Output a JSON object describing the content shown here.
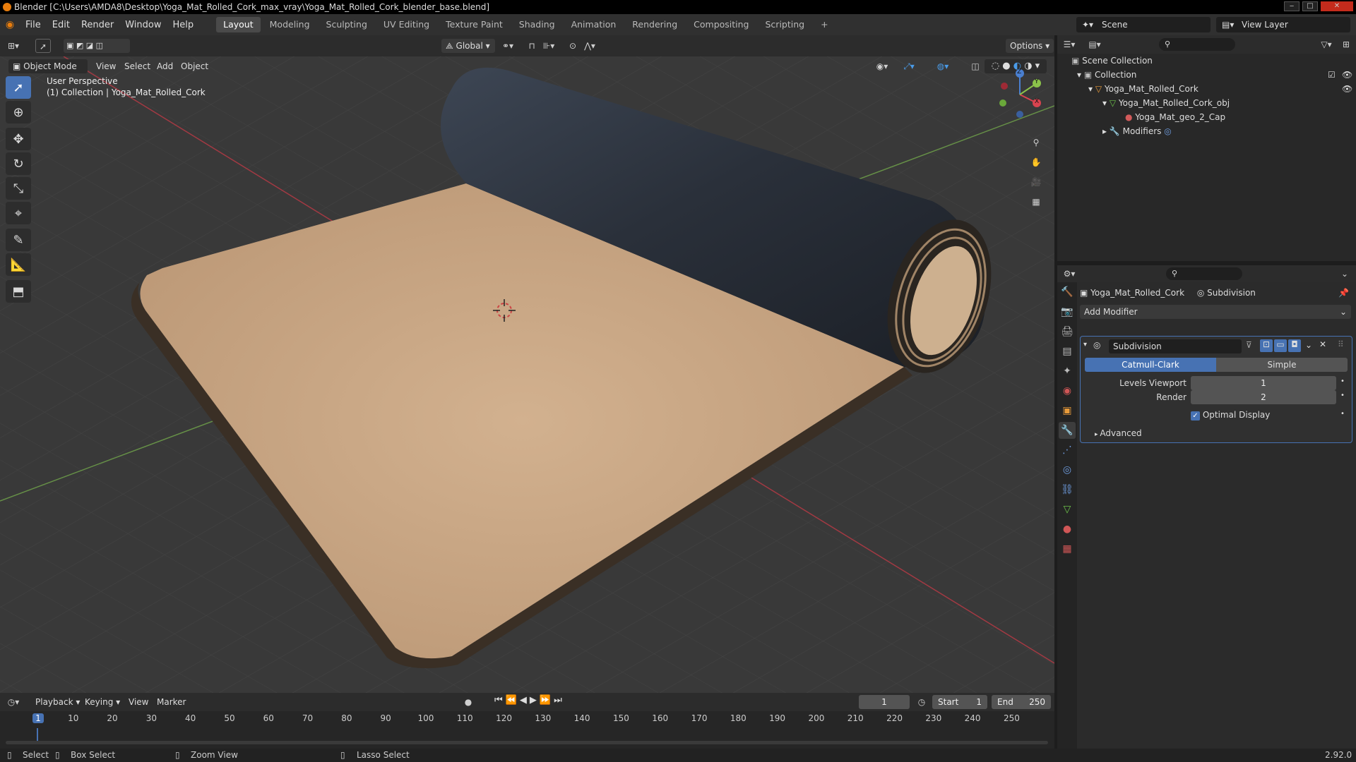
{
  "window": {
    "title": "Blender [C:\\Users\\AMDA8\\Desktop\\Yoga_Mat_Rolled_Cork_max_vray\\Yoga_Mat_Rolled_Cork_blender_base.blend]",
    "min_label": "‒",
    "max_label": "□",
    "close_label": "✕"
  },
  "menu": {
    "items": [
      "File",
      "Edit",
      "Render",
      "Window",
      "Help"
    ],
    "workspaces": [
      "Layout",
      "Modeling",
      "Sculpting",
      "UV Editing",
      "Texture Paint",
      "Shading",
      "Animation",
      "Rendering",
      "Compositing",
      "Scripting"
    ],
    "add_tab": "+",
    "scene_label": "Scene",
    "view_layer_label": "View Layer"
  },
  "viewport_header": {
    "transform_orientation": "Global",
    "options_label": "Options",
    "mode": "Object Mode",
    "menus": [
      "View",
      "Select",
      "Add",
      "Object"
    ]
  },
  "viewport": {
    "perspective": "User Perspective",
    "collection_info": "(1) Collection | Yoga_Mat_Rolled_Cork",
    "gizmo_x": "X",
    "gizmo_y": "Y",
    "gizmo_z": "Z"
  },
  "outliner": {
    "search_placeholder": "",
    "rows": [
      {
        "label": "Scene Collection"
      },
      {
        "label": "Collection"
      },
      {
        "label": "Yoga_Mat_Rolled_Cork"
      },
      {
        "label": "Yoga_Mat_Rolled_Cork_obj"
      },
      {
        "label": "Yoga_Mat_geo_2_Cap"
      },
      {
        "label": "Modifiers"
      }
    ]
  },
  "properties": {
    "object_name": "Yoga_Mat_Rolled_Cork",
    "modifier_context": "Subdivision",
    "add_modifier": "Add Modifier",
    "modifier": {
      "name": "Subdivision",
      "type_options": [
        "Catmull-Clark",
        "Simple"
      ],
      "selected_type": "Catmull-Clark",
      "levels_viewport_label": "Levels Viewport",
      "levels_viewport_value": "1",
      "render_label": "Render",
      "render_value": "2",
      "optimal_display_label": "Optimal Display",
      "optimal_display_checked": true,
      "advanced_label": "Advanced"
    }
  },
  "timeline": {
    "menus": [
      "Playback",
      "Keying",
      "View",
      "Marker"
    ],
    "current_frame": "1",
    "start_label": "Start",
    "start_value": "1",
    "end_label": "End",
    "end_value": "250",
    "ticks": [
      "1",
      "10",
      "20",
      "30",
      "40",
      "50",
      "60",
      "70",
      "80",
      "90",
      "100",
      "110",
      "120",
      "130",
      "140",
      "150",
      "160",
      "170",
      "180",
      "190",
      "200",
      "210",
      "220",
      "230",
      "240",
      "250"
    ]
  },
  "status_bar": {
    "select": "Select",
    "box_select": "Box Select",
    "zoom_view": "Zoom View",
    "lasso_select": "Lasso Select",
    "version": "2.92.0"
  },
  "colors": {
    "accent": "#4772b3",
    "active_frame": "#4772b3",
    "cork": "#c9a682",
    "mat_top": "#2f3540",
    "x_axis": "#b53a45",
    "y_axis": "#6ea04a"
  }
}
